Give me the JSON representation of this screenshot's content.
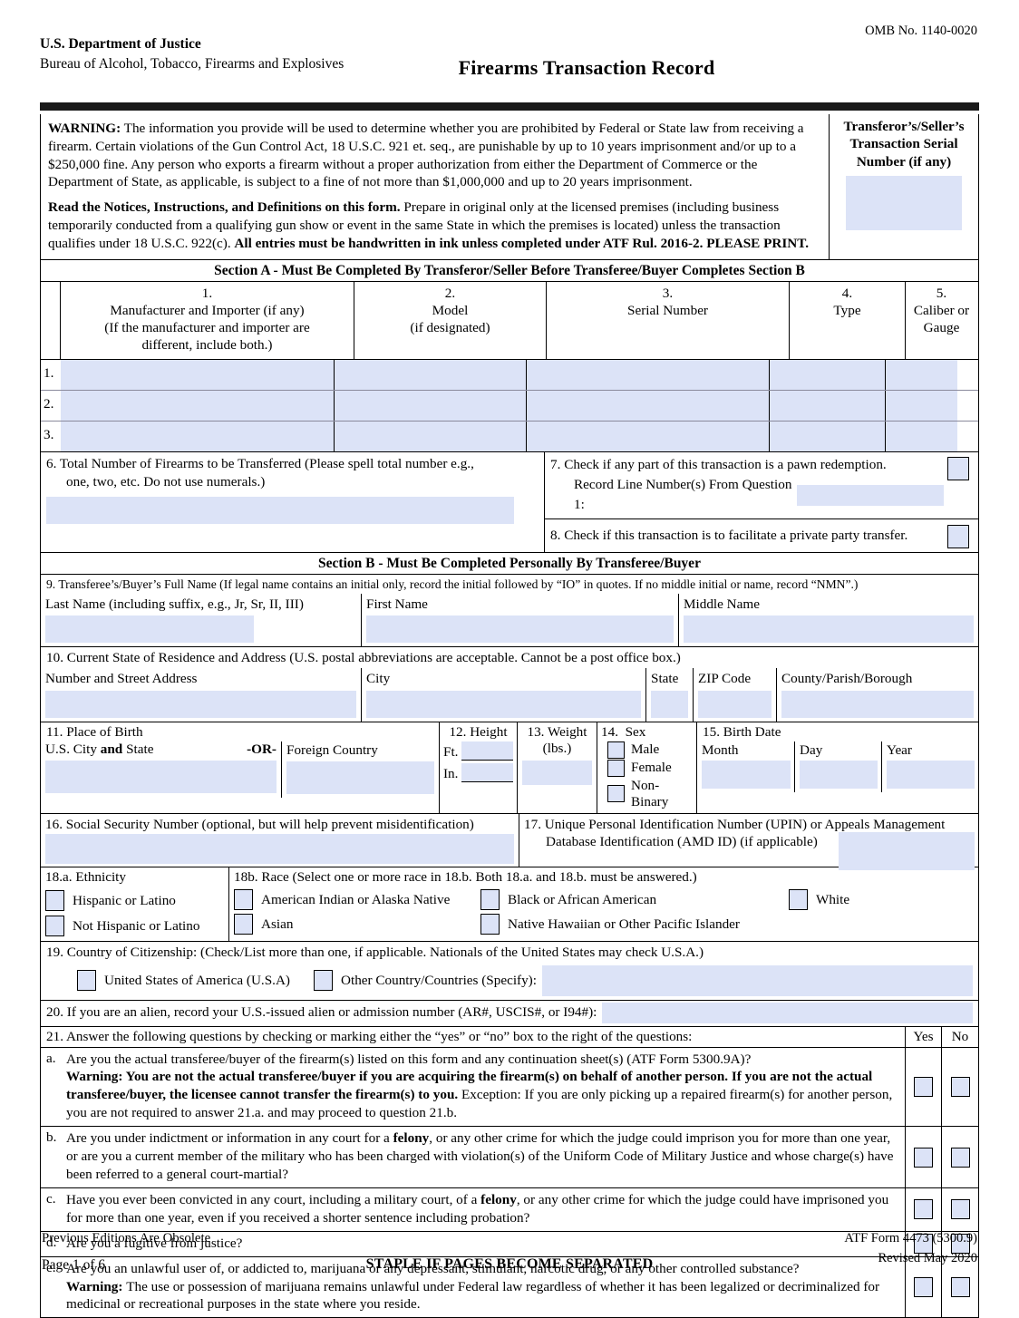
{
  "header": {
    "omb": "OMB No. 1140-0020",
    "agency": "U.S. Department of Justice",
    "bureau": "Bureau of Alcohol, Tobacco, Firearms and Explosives",
    "title": "Firearms Transaction Record"
  },
  "warning": {
    "p1_bold": "WARNING:",
    "p1": "  The information you provide will be used to determine whether you are prohibited by Federal or State law from receiving a firearm.  Certain violations of the Gun Control Act, 18 U.S.C. 921 et. seq., are punishable by up to 10 years imprisonment and/or up to a $250,000 fine.  Any person who exports a firearm without a proper authorization from either the Department of  Commerce or the Department of State, as applicable, is subject to a fine of not more than $1,000,000 and up to 20 years imprisonment.",
    "p2_bold": "Read the Notices, Instructions, and Definitions on this form.",
    "p2_mid": "  Prepare in original only at the licensed premises (including business temporarily conducted from a qualifying gun show or event in the same State in which the premises is located) unless the transaction qualifies under 18 U.S.C. 922(c).  ",
    "p2_bold2": "All entries must be handwritten in ink unless completed under ATF Rul. 2016-2.  PLEASE PRINT.",
    "serial_label_l1": "Transferor’s/Seller’s",
    "serial_label_l2": "Transaction Serial",
    "serial_label_l3": "Number (if any)",
    "serial_value": ""
  },
  "section_a": {
    "title": "Section A - Must Be Completed By Transferor/Seller Before Transferee/Buyer Completes Section B",
    "columns": [
      {
        "num": "1.",
        "l1": "Manufacturer and Importer (if any)",
        "l2": "(If the manufacturer and importer are",
        "l3": "different, include both.)"
      },
      {
        "num": "2.",
        "l1": "Model",
        "l2": "(if designated)",
        "l3": ""
      },
      {
        "num": "3.",
        "l1": "Serial Number",
        "l2": "",
        "l3": ""
      },
      {
        "num": "4.",
        "l1": "Type",
        "l2": "",
        "l3": ""
      },
      {
        "num": "5.",
        "l1": "Caliber or",
        "l2": "Gauge",
        "l3": ""
      }
    ],
    "rows": [
      {
        "idx": "1.",
        "manufacturer": "",
        "model": "",
        "serial": "",
        "type": "",
        "caliber": ""
      },
      {
        "idx": "2.",
        "manufacturer": "",
        "model": "",
        "serial": "",
        "type": "",
        "caliber": ""
      },
      {
        "idx": "3.",
        "manufacturer": "",
        "model": "",
        "serial": "",
        "type": "",
        "caliber": ""
      }
    ],
    "q6": {
      "num": "6.",
      "l1": "Total Number of Firearms to be Transferred (Please spell total number e.g.,",
      "l2": "one, two, etc.  Do not use numerals.)",
      "value": ""
    },
    "q7": {
      "num": "7.",
      "text": "Check if any part of this transaction is a pawn redemption.",
      "sub_label": "Record Line Number(s) From Question 1:",
      "sub_value": "",
      "checked": false
    },
    "q8": {
      "num": "8.",
      "text": "Check if this transaction is to facilitate a private party transfer.",
      "checked": false
    }
  },
  "section_b": {
    "title": "Section B - Must Be Completed Personally By Transferee/Buyer",
    "q9": {
      "prompt": "9.  Transferee’s/Buyer’s Full Name (If legal name contains an initial only, record the initial followed by “IO” in quotes.  If no middle initial or name, record “NMN”.)",
      "last_label": "Last Name (including suffix, e.g., Jr, Sr, II, III)",
      "first_label": "First Name",
      "middle_label": "Middle Name",
      "last_value": "",
      "first_value": "",
      "middle_value": ""
    },
    "q10": {
      "prompt": "10.  Current State of Residence and Address  (U.S. postal abbreviations are acceptable.  Cannot be a post office box.)",
      "street_label": "Number and Street Address",
      "city_label": "City",
      "state_label": "State",
      "zip_label": "ZIP Code",
      "county_label": "County/Parish/Borough",
      "street_value": "",
      "city_value": "",
      "state_value": "",
      "zip_value": "",
      "county_value": ""
    },
    "q11": {
      "header": "11.  Place of Birth",
      "us_label_a": "U.S. City ",
      "us_label_b": "and",
      "us_label_c": " State",
      "or": "-OR-",
      "foreign_label": "Foreign Country",
      "us_value": "",
      "foreign_value": ""
    },
    "q12": {
      "num": "12.",
      "label": "Height",
      "ft_label": "Ft.",
      "in_label": "In.",
      "ft_value": "",
      "in_value": ""
    },
    "q13": {
      "num": "13.",
      "label": "Weight",
      "unit": "(lbs.)",
      "value": ""
    },
    "q14": {
      "num": "14.",
      "label": "Sex",
      "options": [
        {
          "label": "Male",
          "checked": false
        },
        {
          "label": "Female",
          "checked": false
        },
        {
          "label": "Non-Binary",
          "checked": false
        }
      ]
    },
    "q15": {
      "header": "15.  Birth Date",
      "month_label": "Month",
      "day_label": "Day",
      "year_label": "Year",
      "month_value": "",
      "day_value": "",
      "year_value": ""
    },
    "q16": {
      "label": "16.  Social Security Number (optional, but will help prevent misidentification)",
      "value": ""
    },
    "q17": {
      "num": "17.",
      "l1": " Unique Personal Identification Number (UPIN) or Appeals Management",
      "l2": "Database Identification (AMD ID) (if applicable)",
      "value": ""
    },
    "q18a": {
      "header": "18.a.  Ethnicity",
      "options": [
        {
          "label": "Hispanic or Latino",
          "checked": false
        },
        {
          "label": "Not Hispanic or Latino",
          "checked": false
        }
      ]
    },
    "q18b": {
      "header": "18b. Race (Select one or more race in 18.b.  Both 18.a. and 18.b. must be answered.)",
      "row1": [
        {
          "label": "American Indian or Alaska Native",
          "checked": false
        },
        {
          "label": "Black or African American",
          "checked": false
        },
        {
          "label": "White",
          "checked": false
        }
      ],
      "row2": [
        {
          "label": "Asian",
          "checked": false
        },
        {
          "label": "Native Hawaiian or Other Pacific Islander",
          "checked": false
        }
      ]
    },
    "q19": {
      "prompt": "19.  Country of Citizenship:  (Check/List more than one, if applicable.  Nationals of the United States may check U.S.A.)",
      "usa_label": "United States of America (U.S.A)",
      "other_label": "Other Country/Countries (Specify):",
      "usa_checked": false,
      "other_checked": false,
      "other_value": ""
    },
    "q20": {
      "prompt": "20.  If you are an alien, record your U.S.-issued alien or admission number (AR#, USCIS#, or I94#):",
      "value": ""
    },
    "q21": {
      "prompt": "21.  Answer the following questions by checking or marking either the “yes” or “no” box to the right of the questions:",
      "yes_header": "Yes",
      "no_header": "No",
      "items": [
        {
          "letter": "a.",
          "line1": "Are you the actual transferee/buyer of the firearm(s) listed on this form and any continuation sheet(s) (ATF Form 5300.9A)?",
          "warning_bold": "Warning:  You are not the actual transferee/buyer if you are acquiring the firearm(s) on behalf of another person.  If you are not the actual transferee/buyer, the licensee cannot transfer the firearm(s) to you.  ",
          "warning_rest": "Exception: If you are only picking up a repaired firearm(s) for another person, you are not required to answer 21.a. and may proceed to question 21.b.",
          "yes": false,
          "no": false
        },
        {
          "letter": "b.",
          "line1_a": "Are you under indictment or information in any court for a ",
          "line1_bold": "felony",
          "line1_b": ", or any other crime for which the judge could imprison you for more than one year, or are you a current member of the military who has been charged with violation(s) of the Uniform Code of Military Justice and whose charge(s) have been referred to a general court-martial?",
          "yes": false,
          "no": false
        },
        {
          "letter": "c.",
          "line1_a": "Have you ever been convicted in any court, including a military court, of a ",
          "line1_bold": "felony",
          "line1_b": ", or any other crime for which the judge could have imprisoned you for more than one year, even if you received a shorter sentence including probation?",
          "yes": false,
          "no": false
        },
        {
          "letter": "d.",
          "line1": "Are you a fugitive from justice?",
          "yes": false,
          "no": false
        },
        {
          "letter": "e.",
          "line1": "Are you an unlawful user of, or addicted to, marijuana or any depressant, stimulant, narcotic drug, or any other controlled substance?",
          "warning_bold": "Warning:  ",
          "warning_rest": "The use or possession of marijuana remains unlawful under Federal law regardless of whether it has been legalized or decriminalized for medicinal or recreational purposes in the state where you reside.",
          "yes": false,
          "no": false
        }
      ]
    }
  },
  "footer": {
    "previous_editions": "Previous Editions Are Obsolete",
    "page": "Page 1 of 6",
    "staple": "STAPLE IF PAGES BECOME SEPARATED",
    "form_no": "ATF Form 4473 (5300.9)",
    "revised": "Revised May 2020"
  }
}
